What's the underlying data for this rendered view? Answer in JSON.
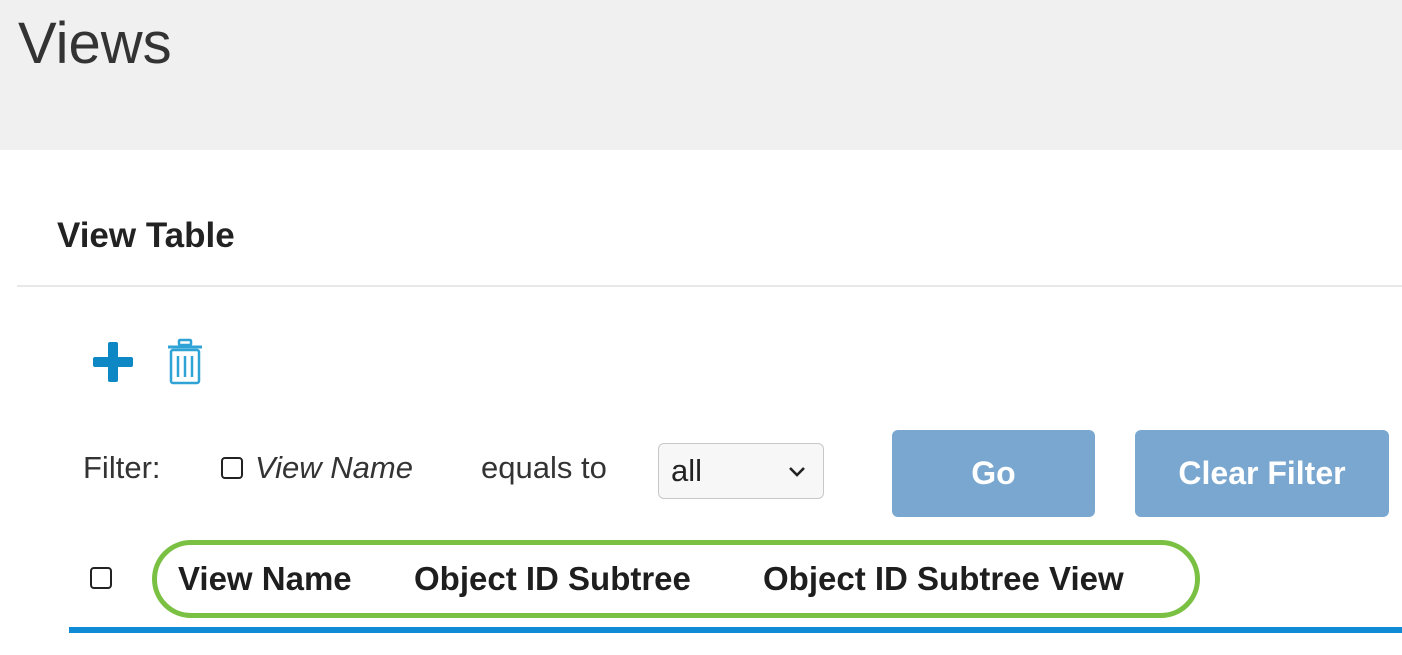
{
  "page": {
    "title": "Views"
  },
  "panel": {
    "title": "View Table"
  },
  "toolbar": {
    "add_icon": "plus-icon",
    "delete_icon": "trash-icon",
    "accent_color": "#0e87c5"
  },
  "filter": {
    "label": "Filter:",
    "checked": false,
    "field": "View Name",
    "operator": "equals to",
    "selected_value": "all",
    "go_label": "Go",
    "clear_label": "Clear Filter",
    "button_color": "#79a7d0"
  },
  "table": {
    "columns": [
      "View Name",
      "Object ID Subtree",
      "Object ID Subtree View"
    ],
    "header_highlight_color": "#7ac043",
    "header_rule_color": "#0f8ad4"
  }
}
